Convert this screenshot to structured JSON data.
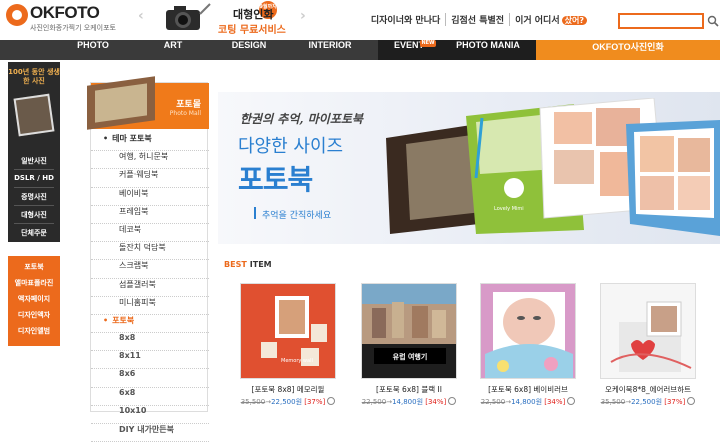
{
  "header": {
    "logo": "OKFOTO",
    "logo_sub": "사진인화종가찍기 오케이포토",
    "promo_title": "대형인화",
    "promo_sub": "코팅 무료서비스",
    "promo_badge": "9월까지",
    "links": [
      "디자이너와 만나다",
      "김점선 특별전",
      "이거 어디서"
    ],
    "links_badge": "샀어?",
    "search_placeholder": ""
  },
  "nav": {
    "items": [
      "PHOTO",
      "ART",
      "DESIGN",
      "INTERIOR",
      "EVENT",
      "PHOTO MANIA",
      "OKFOTO사진인화"
    ],
    "event_badge": "NEW"
  },
  "left_rail": {
    "title": "100년 동안 생생한 사진",
    "items": [
      "일반사진",
      "DSLR / HD",
      "증명사진",
      "대형사진",
      "단체주문"
    ]
  },
  "left_rail2": {
    "items": [
      "포토북",
      "앨마표폴라진",
      "액자페이지",
      "디자인액자",
      "디자인앨범"
    ]
  },
  "category": {
    "title": "포토몰",
    "subtitle": "Photo Mall",
    "rows": [
      {
        "label": "테마 포토북",
        "type": "head"
      },
      {
        "label": "여행, 허니문북",
        "type": "item"
      },
      {
        "label": "커플·웨딩북",
        "type": "item"
      },
      {
        "label": "베이비북",
        "type": "item"
      },
      {
        "label": "프레임북",
        "type": "item"
      },
      {
        "label": "데코북",
        "type": "item"
      },
      {
        "label": "돌잔치 덕담북",
        "type": "item"
      },
      {
        "label": "스크랩북",
        "type": "item"
      },
      {
        "label": "섬플갤러북",
        "type": "item"
      },
      {
        "label": "미니홈피북",
        "type": "item"
      },
      {
        "label": "포토북",
        "type": "head-active"
      },
      {
        "label": "8x8",
        "type": "sub"
      },
      {
        "label": "8x11",
        "type": "sub"
      },
      {
        "label": "8x6",
        "type": "sub"
      },
      {
        "label": "6x8",
        "type": "sub"
      },
      {
        "label": "10x10",
        "type": "sub"
      },
      {
        "label": "DIY 내가만든북",
        "type": "sub"
      }
    ]
  },
  "banner": {
    "line1": "한권의 추억, 마이포토북",
    "line2": "다양한 사이즈",
    "line3": "포토북",
    "line4": "추억을 간직하세요",
    "book_label": "Lovely Mimi"
  },
  "best": {
    "label1": "BEST",
    "label2": "ITEM"
  },
  "products": [
    {
      "name": "[포토북 8x8] 메모리윌",
      "old": "35,500",
      "new": "22,500원",
      "disc": "[37%]",
      "tag": "Memory wall"
    },
    {
      "name": "[포토북 6x8] 블랙 II",
      "old": "22,500",
      "new": "14,800원",
      "disc": "[34%]",
      "tag": "유럽 여행기"
    },
    {
      "name": "[포토북 6x8] 베이비러브",
      "old": "22,500",
      "new": "14,800원",
      "disc": "[34%]",
      "tag": ""
    },
    {
      "name": "오케이북8*8_에어러브하트",
      "old": "35,500",
      "new": "22,500원",
      "disc": "[37%]",
      "tag": ""
    }
  ],
  "colors": {
    "accent": "#ec6a1c",
    "nav": "#3a3a3a",
    "blue": "#2a7fd0"
  }
}
